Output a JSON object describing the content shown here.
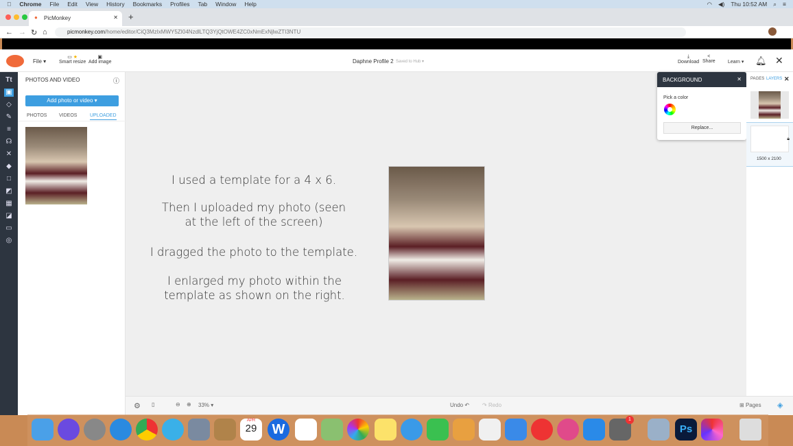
{
  "menubar": {
    "items": [
      "Chrome",
      "File",
      "Edit",
      "View",
      "History",
      "Bookmarks",
      "Profiles",
      "Tab",
      "Window",
      "Help"
    ],
    "clock": "Thu 10:52 AM"
  },
  "browser": {
    "tab_title": "PicMonkey",
    "url_domain": "picmonkey.com",
    "url_path": "/home/editor/CiQ3MzIxMWY5ZI04NzdlLTQ3YjQtOWE4ZC0xNmExNjlwZTI3NTU"
  },
  "header": {
    "file": "File",
    "smart_resize": "Smart resize",
    "add_image": "Add image",
    "doc_title": "Daphne Profile 2",
    "saved": "Saved to Hub",
    "download": "Download",
    "share": "Share",
    "learn": "Learn"
  },
  "panel": {
    "title": "PHOTOS AND VIDEO",
    "add_button": "Add photo or video",
    "tabs": [
      "PHOTOS",
      "VIDEOS",
      "UPLOADED"
    ],
    "active_tab": "UPLOADED"
  },
  "canvas": {
    "notes": [
      "I used a template for a 4 x 6.",
      "Then I uploaded my photo (seen at the left of the screen)",
      "I dragged the photo to the template.",
      "I enlarged my photo within the template as shown on the right."
    ]
  },
  "background_popup": {
    "title": "BACKGROUND",
    "pick_color": "Pick a color",
    "replace": "Replace..."
  },
  "layers": {
    "tabs": [
      "PAGES",
      "LAYERS"
    ],
    "active_tab": "LAYERS",
    "size": "1500 x 2100"
  },
  "bottom": {
    "zoom": "33%",
    "undo": "Undo",
    "redo": "Redo",
    "pages": "Pages"
  },
  "dock": {
    "calendar_month": "APR",
    "calendar_day": "29",
    "appstore_badge": "1"
  },
  "colors": {
    "accent": "#3d9ee0",
    "rail": "#2d3540",
    "popup_header": "#2d3540"
  }
}
